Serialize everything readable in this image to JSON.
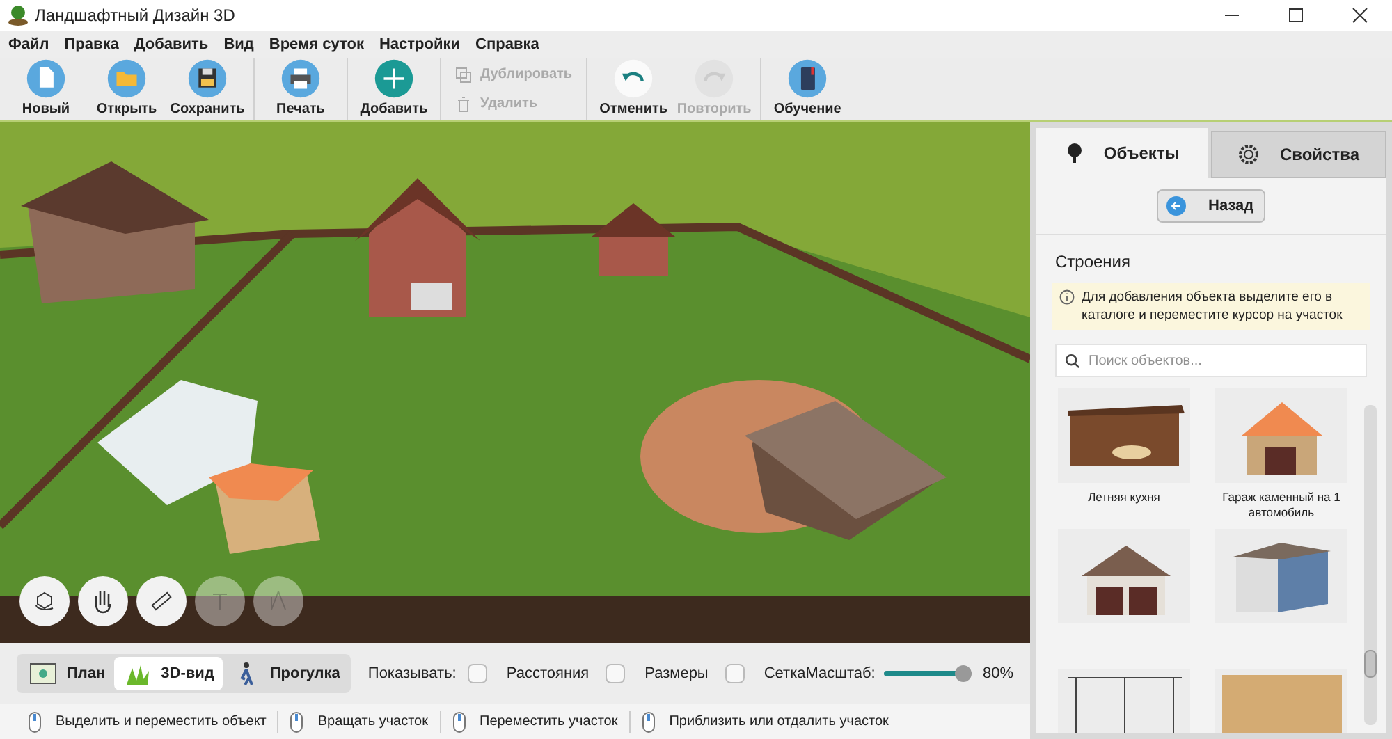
{
  "window": {
    "title": "Ландшафтный Дизайн 3D"
  },
  "menu": [
    "Файл",
    "Правка",
    "Добавить",
    "Вид",
    "Время суток",
    "Настройки",
    "Справка"
  ],
  "toolbar": {
    "groups": [
      [
        {
          "label": "Новый",
          "kind": "round",
          "disabled": false
        },
        {
          "label": "Открыть",
          "kind": "round",
          "disabled": false
        },
        {
          "label": "Сохранить",
          "kind": "round",
          "disabled": false
        }
      ],
      [
        {
          "label": "Печать",
          "kind": "round",
          "disabled": false
        }
      ],
      [
        {
          "label": "Добавить",
          "kind": "round",
          "disabled": false
        }
      ],
      [
        {
          "label": "Дублировать",
          "kind": "small",
          "disabled": true
        },
        {
          "label": "Удалить",
          "kind": "small",
          "disabled": true
        }
      ],
      [
        {
          "label": "Отменить",
          "kind": "round",
          "disabled": false
        },
        {
          "label": "Повторить",
          "kind": "round",
          "disabled": true
        }
      ],
      [
        {
          "label": "Обучение",
          "kind": "round",
          "disabled": false
        }
      ]
    ]
  },
  "viewport_tools": [
    {
      "disabled": false
    },
    {
      "disabled": false
    },
    {
      "disabled": false
    },
    {
      "disabled": true
    },
    {
      "disabled": true
    }
  ],
  "view_tabs": [
    {
      "label": "План",
      "selected": false
    },
    {
      "label": "3D-вид",
      "selected": true
    },
    {
      "label": "Прогулка",
      "selected": false
    }
  ],
  "show": {
    "label": "Показывать:",
    "options": [
      {
        "label": "Расстояния",
        "checked": false
      },
      {
        "label": "Размеры",
        "checked": false
      },
      {
        "label": "Сетка",
        "checked": false
      }
    ]
  },
  "zoom": {
    "label": "Масштаб:",
    "level": 0.9,
    "reading": "80%"
  },
  "status_bar": [
    "Выделить и переместить объект",
    "Вращать участок",
    "Переместить участок",
    "Приблизить или отдалить участок"
  ],
  "panel": {
    "tabs": [
      {
        "label": "Объекты",
        "selected": true
      },
      {
        "label": "Свойства",
        "selected": false
      }
    ],
    "back_button": "Назад",
    "section_title": "Строения",
    "hint": "Для добавления объекта выделите его в каталоге и переместите курсор на участок",
    "search": {
      "placeholder": "Поиск объектов..."
    },
    "items": [
      {
        "label": "Летняя кухня"
      },
      {
        "label": "Гараж каменный на 1 автомобиль"
      }
    ]
  }
}
